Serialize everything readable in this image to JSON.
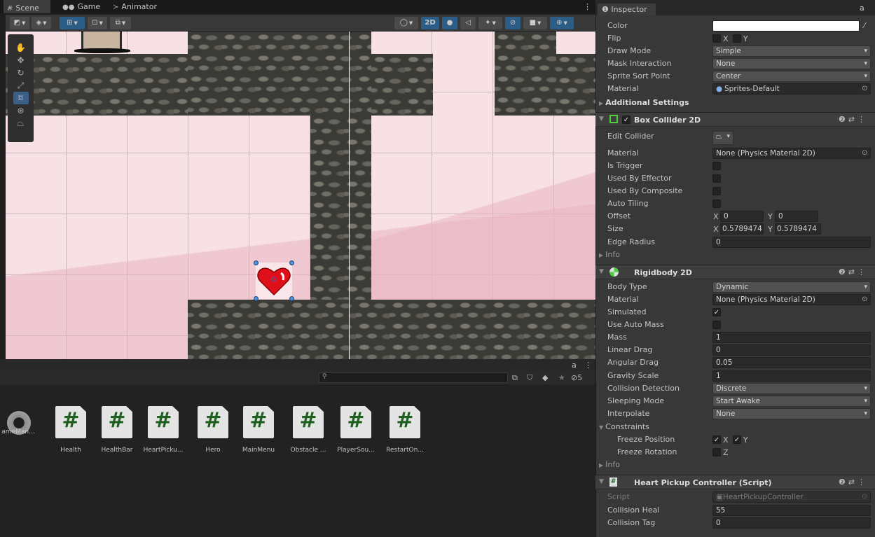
{
  "tabs": {
    "scene": "Scene",
    "game": "Game",
    "animator": "Animator"
  },
  "toolbar": {
    "mode2d": "2D"
  },
  "project": {
    "assets": [
      "ameMan...",
      "Health",
      "HealthBar",
      "HeartPicku...",
      "Hero",
      "MainMenu",
      "Obstacle ...",
      "PlayerSou...",
      "RestartOn..."
    ],
    "script_glyph": "#",
    "hidden_count": "5"
  },
  "inspector": {
    "title": "Inspector",
    "sprite": {
      "color_label": "Color",
      "flip_label": "Flip",
      "flip_x": "X",
      "flip_y": "Y",
      "draw_mode_label": "Draw Mode",
      "draw_mode": "Simple",
      "mask_label": "Mask Interaction",
      "mask": "None",
      "sort_label": "Sprite Sort Point",
      "sort": "Center",
      "material_label": "Material",
      "material": "Sprites-Default",
      "additional": "Additional Settings"
    },
    "box": {
      "title": "Box Collider 2D",
      "edit_label": "Edit Collider",
      "material_label": "Material",
      "material": "None (Physics Material 2D)",
      "trigger_label": "Is Trigger",
      "effector_label": "Used By Effector",
      "composite_label": "Used By Composite",
      "tiling_label": "Auto Tiling",
      "offset_label": "Offset",
      "offset_x": "0",
      "offset_y": "0",
      "size_label": "Size",
      "size_x": "0.5789474",
      "size_y": "0.5789474",
      "edge_label": "Edge Radius",
      "edge": "0",
      "info": "Info"
    },
    "rb": {
      "title": "Rigidbody 2D",
      "body_label": "Body Type",
      "body": "Dynamic",
      "material_label": "Material",
      "material": "None (Physics Material 2D)",
      "simulated_label": "Simulated",
      "automass_label": "Use Auto Mass",
      "mass_label": "Mass",
      "mass": "1",
      "lin_label": "Linear Drag",
      "lin": "0",
      "ang_label": "Angular Drag",
      "ang": "0.05",
      "grav_label": "Gravity Scale",
      "grav": "1",
      "coll_label": "Collision Detection",
      "coll": "Discrete",
      "sleep_label": "Sleeping Mode",
      "sleep": "Start Awake",
      "interp_label": "Interpolate",
      "interp": "None",
      "constraints": "Constraints",
      "fpos_label": "Freeze Position",
      "fx": "X",
      "fy": "Y",
      "frot_label": "Freeze Rotation",
      "fz": "Z",
      "info": "Info"
    },
    "script": {
      "title": "Heart Pickup Controller (Script)",
      "script_label": "Script",
      "script": "HeartPickupController",
      "heal_label": "Collision Heal",
      "heal": "55",
      "tag_label": "Collision Tag",
      "tag": "0"
    },
    "axis_x": "X",
    "axis_y": "Y"
  }
}
